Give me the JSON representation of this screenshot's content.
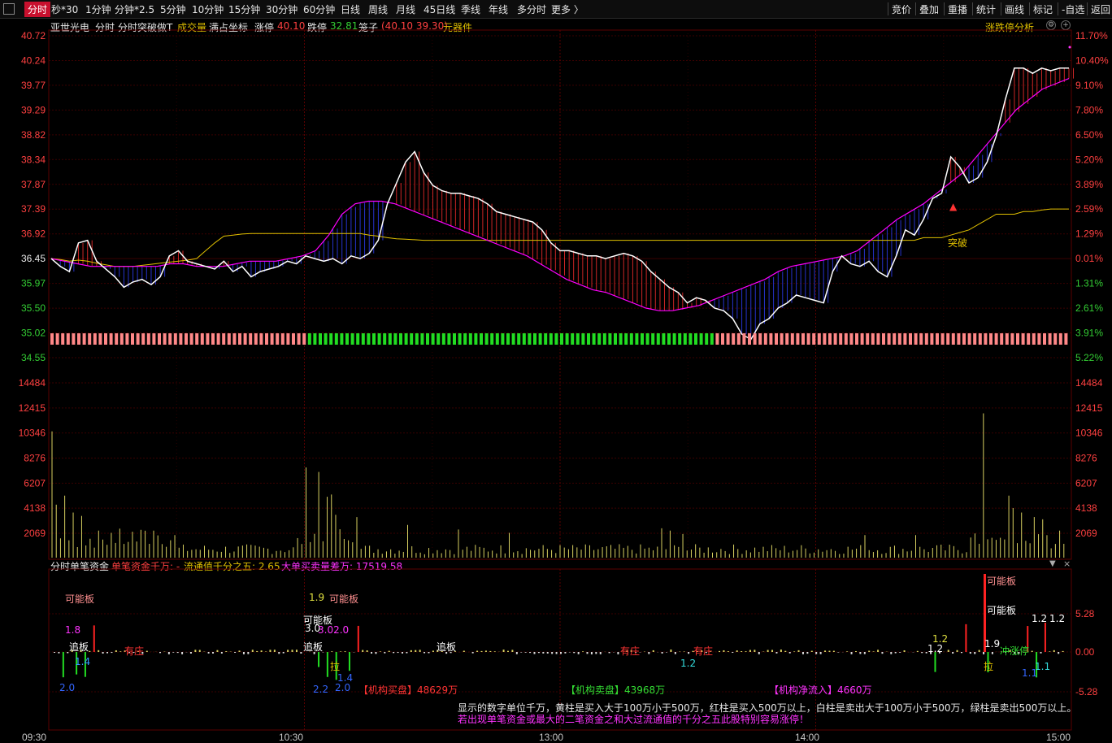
{
  "toolbar": {
    "tabs": [
      "分时",
      "秒*30",
      "1分钟",
      "分钟*2.5",
      "5分钟",
      "10分钟",
      "15分钟",
      "30分钟",
      "60分钟",
      "日线",
      "周线",
      "月线",
      "45日线",
      "季线",
      "年线",
      "多分时",
      "更多 〉"
    ],
    "right": [
      "竞价",
      "叠加",
      "重播",
      "统计",
      "画线",
      "标记",
      "-自选",
      "返回"
    ]
  },
  "header": {
    "stock": "亚世光电",
    "mode": "分时",
    "indicator": "分时突破做T",
    "volume_label": "成交量",
    "coord_label": "满占坐标",
    "limit_up_label": "涨停",
    "limit_up_value": "40.10",
    "limit_down_label": "跌停",
    "limit_down_value": "32.81",
    "cage_label": "笼子",
    "cage_value": "(40.10 39.30)",
    "sector": "元器件",
    "right_label": "涨跌停分析"
  },
  "colors": {
    "up": "#ff3333",
    "down": "#00d000",
    "grid": "#3a0000",
    "price_line": "#ffffff",
    "avg_line": "#e0c000",
    "ma_line": "#ff00ff",
    "volume": "#d8d060",
    "axis_up": "#ff4040",
    "axis_down": "#33cc33",
    "pink_bar": "#ff8888",
    "green_bar": "#22dd22"
  },
  "chart_data": [
    {
      "type": "line",
      "name": "price",
      "y_ticks_left": [
        "40.72",
        "40.24",
        "39.77",
        "39.29",
        "38.82",
        "38.34",
        "37.87",
        "37.39",
        "36.92",
        "36.45",
        "35.97",
        "35.50",
        "35.02",
        "34.55"
      ],
      "y_ticks_right": [
        "11.70%",
        "10.40%",
        "9.10%",
        "7.80%",
        "6.50%",
        "5.20%",
        "3.89%",
        "2.59%",
        "1.29%",
        "0.01%",
        "1.31%",
        "2.61%",
        "3.91%",
        "5.22%"
      ],
      "x_ticks": [
        "09:30",
        "10:30",
        "13:00",
        "14:00",
        "15:00"
      ],
      "ylim": [
        34.55,
        40.72
      ],
      "series": [
        {
          "values": [
            36.45,
            36.3,
            36.2,
            36.75,
            36.8,
            36.4,
            36.25,
            36.1,
            35.9,
            36.0,
            36.05,
            35.95,
            36.1,
            36.5,
            36.6,
            36.4,
            36.35,
            36.3,
            36.25,
            36.4,
            36.2,
            36.3,
            36.1,
            36.2,
            36.25,
            36.3,
            36.4,
            36.35,
            36.5,
            36.45,
            36.4,
            36.45,
            36.35,
            36.5,
            36.45,
            36.55,
            36.8,
            37.5,
            37.9,
            38.3,
            38.5,
            38.1,
            37.85,
            37.75,
            37.7,
            37.7,
            37.65,
            37.6,
            37.5,
            37.35,
            37.3,
            37.25,
            37.2,
            37.15,
            37.0,
            36.75,
            36.6,
            36.6,
            36.55,
            36.5,
            36.5,
            36.45,
            36.5,
            36.55,
            36.5,
            36.4,
            36.2,
            36.05,
            35.9,
            35.8,
            35.6,
            35.7,
            35.65,
            35.5,
            35.45,
            35.3,
            35.0,
            34.9,
            35.2,
            35.3,
            35.5,
            35.6,
            35.75,
            35.7,
            35.65,
            35.6,
            36.2,
            36.5,
            36.35,
            36.3,
            36.4,
            36.2,
            36.1,
            36.5,
            37.0,
            36.9,
            37.2,
            37.6,
            37.7,
            38.4,
            38.2,
            37.9,
            38.0,
            38.3,
            38.8,
            39.5,
            40.1,
            40.1,
            40.0,
            40.1,
            40.05,
            40.1,
            40.1
          ]
        },
        {
          "values": [
            36.45,
            36.43,
            36.4,
            36.42,
            36.4,
            36.36,
            36.33,
            36.3,
            36.3,
            36.3,
            36.32,
            36.34,
            36.36,
            36.38,
            36.4,
            36.42,
            36.45,
            36.6,
            36.75,
            36.88,
            36.9,
            36.92,
            36.93,
            36.93,
            36.93,
            36.93,
            36.93,
            36.93,
            36.93,
            36.93,
            36.93,
            36.93,
            36.93,
            36.93,
            36.93,
            36.9,
            36.88,
            36.85,
            36.83,
            36.82,
            36.81,
            36.8,
            36.8,
            36.8,
            36.8,
            36.8,
            36.8,
            36.8,
            36.8,
            36.8,
            36.8,
            36.8,
            36.8,
            36.8,
            36.8,
            36.8,
            36.8,
            36.8,
            36.8,
            36.8,
            36.8,
            36.8,
            36.8,
            36.8,
            36.8,
            36.8,
            36.8,
            36.8,
            36.8,
            36.8,
            36.8,
            36.8,
            36.8,
            36.8,
            36.8,
            36.8,
            36.8,
            36.8,
            36.8,
            36.8,
            36.8,
            36.8,
            36.8,
            36.8,
            36.8,
            36.8,
            36.8,
            36.8,
            36.8,
            36.8,
            36.8,
            36.8,
            36.8,
            36.8,
            36.8,
            36.8,
            36.85,
            36.85,
            36.85,
            36.9,
            36.95,
            37.0,
            37.1,
            37.2,
            37.3,
            37.3,
            37.3,
            37.35,
            37.35,
            37.38,
            37.4,
            37.4,
            37.4
          ]
        },
        {
          "values": [
            36.45,
            36.4,
            36.35,
            36.3,
            36.3,
            36.3,
            36.3,
            36.3,
            36.3,
            36.35,
            36.35,
            36.3,
            36.3,
            36.3,
            36.35,
            36.4,
            36.4,
            36.4,
            36.45,
            36.5,
            36.6,
            36.9,
            37.3,
            37.5,
            37.55,
            37.55,
            37.5,
            37.4,
            37.3,
            37.2,
            37.1,
            37.0,
            36.9,
            36.8,
            36.7,
            36.6,
            36.5,
            36.35,
            36.2,
            36.05,
            35.95,
            35.85,
            35.8,
            35.7,
            35.6,
            35.5,
            35.45,
            35.45,
            35.5,
            35.55,
            35.65,
            35.75,
            35.85,
            35.95,
            36.05,
            36.2,
            36.3,
            36.35,
            36.4,
            36.45,
            36.5,
            36.6,
            36.8,
            37.0,
            37.2,
            37.35,
            37.5,
            37.7,
            37.9,
            38.1,
            38.4,
            38.7,
            39.0,
            39.3,
            39.5,
            39.7,
            39.8,
            39.9
          ]
        }
      ]
    },
    {
      "type": "bar",
      "name": "volume",
      "y_ticks": [
        "14484",
        "12415",
        "10346",
        "8276",
        "6207",
        "4138",
        "2069"
      ],
      "ylim": [
        0,
        15500
      ],
      "peaks": [
        11200,
        4700,
        5500,
        4000,
        3700,
        2400,
        2200,
        2300,
        2400,
        2000,
        8000,
        7600,
        5400,
        5600,
        3800,
        3600,
        2900,
        2500,
        2200,
        2600,
        2400,
        2100,
        2000,
        2000,
        13000,
        12800,
        5500,
        4400,
        4000,
        3600,
        3400,
        2400
      ]
    },
    {
      "type": "bar",
      "name": "分时单笔资金",
      "y_ticks": [
        "5.28",
        "0.00",
        "-5.28"
      ],
      "ylim": [
        -5.28,
        5.28
      ]
    }
  ],
  "volume_header": "",
  "fund_header": {
    "title": "分时单笔资金",
    "single_label": "单笔资金千万: -",
    "float_label": "流通值千分之五: 2.65",
    "big_label": "大单买卖量差万: 17519.58"
  },
  "annotations": {
    "breakout": "突破",
    "possible_limit": "可能板",
    "chase": "追板",
    "has_stop": "有庄",
    "rush": "冲涨停",
    "pull": "拉",
    "open_limit": "可能板",
    "values": [
      "1.8",
      "1.4",
      "2.0",
      "1.9",
      "3.0",
      "3.02.0",
      "1.4",
      "2.2",
      "2.0",
      "1.2",
      "1.2",
      "1.2",
      "1.9",
      "1.1",
      "1.1",
      "1.2",
      "1.2"
    ],
    "buy_label": "【机构买盘】48629万",
    "sell_label": "【机构卖盘】43968万",
    "net_label": "【机构净流入】4660万",
    "note1": "显示的数字单位千万，黄柱是买入大于100万小于500万，红柱是买入500万以上，白柱是卖出大于100万小于500万，绿柱是卖出500万以上。",
    "note2": "若出现单笔资金或最大的二笔资金之和大过流通值的千分之五此股特别容易涨停！"
  }
}
